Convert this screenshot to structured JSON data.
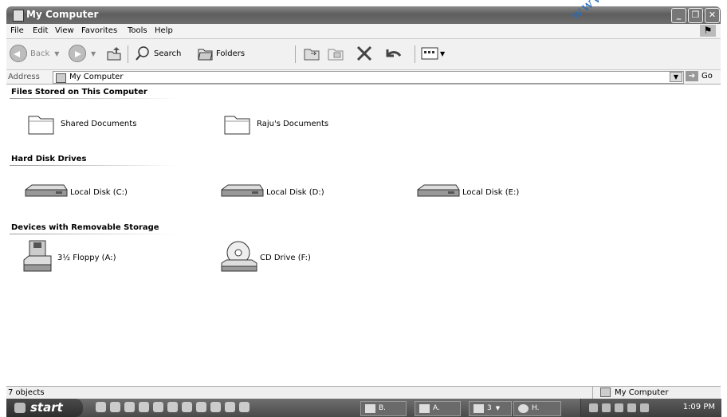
{
  "window": {
    "title": "My Computer",
    "min_label": "_",
    "restore_label": "❐",
    "close_label": "✕"
  },
  "watermark": "www.",
  "menu": [
    "File",
    "Edit",
    "View",
    "Favorites",
    "Tools",
    "Help"
  ],
  "toolbar": {
    "back": "Back",
    "search": "Search",
    "folders": "Folders"
  },
  "address": {
    "label": "Address",
    "value": "My Computer",
    "go": "Go"
  },
  "groups": {
    "files": {
      "title": "Files Stored on This Computer",
      "items": [
        "Shared Documents",
        "Raju's Documents"
      ]
    },
    "hdd": {
      "title": "Hard Disk Drives",
      "items": [
        "Local Disk (C:)",
        "Local Disk (D:)",
        "Local Disk (E:)"
      ]
    },
    "removable": {
      "title": "Devices with Removable Storage",
      "items": [
        "3½ Floppy (A:)",
        "CD Drive (F:)"
      ]
    }
  },
  "status": {
    "left": "7 objects",
    "right": "My Computer"
  },
  "taskbar": {
    "start": "start",
    "tasks": [
      "B.",
      "A.",
      "3",
      "H."
    ],
    "clock": "1:09 PM"
  }
}
